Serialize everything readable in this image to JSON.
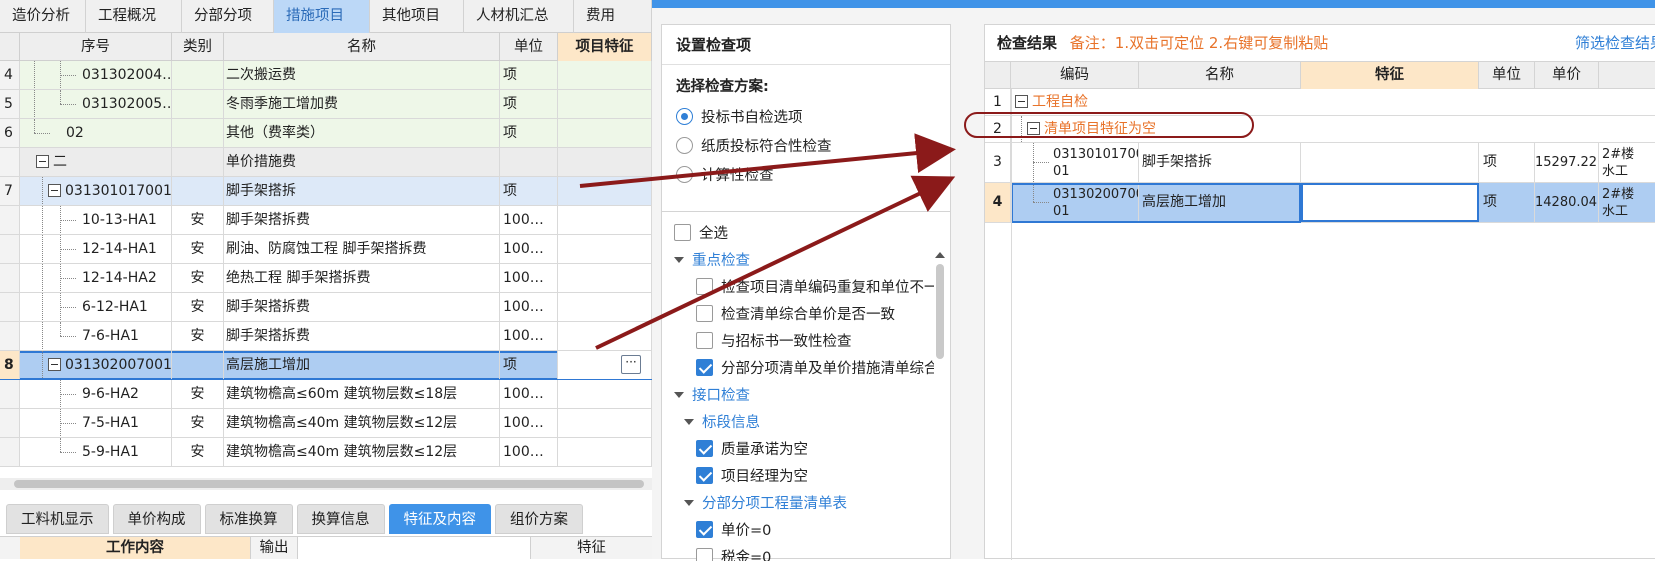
{
  "left": {
    "tabs": [
      {
        "label": "造价分析"
      },
      {
        "label": "工程概况"
      },
      {
        "label": "分部分项"
      },
      {
        "label": "措施项目",
        "active": true
      },
      {
        "label": "其他项目"
      },
      {
        "label": "人材机汇总"
      },
      {
        "label": "费用"
      }
    ],
    "columns": {
      "seq": "序号",
      "type": "类别",
      "name": "名称",
      "unit": "单位",
      "feature": "项目特征"
    },
    "rows": [
      {
        "idx": "4",
        "seq": "031302004…",
        "type": "",
        "name": "二次搬运费",
        "unit": "项"
      },
      {
        "idx": "5",
        "seq": "031302005…",
        "type": "",
        "name": "冬雨季施工增加费",
        "unit": "项"
      },
      {
        "idx": "6",
        "seq": "02",
        "type": "",
        "name": "其他（费率类）",
        "unit": "项"
      },
      {
        "idx": "",
        "seq": "二",
        "type": "",
        "name": "单价措施费",
        "unit": ""
      },
      {
        "idx": "7",
        "seq": "031301017001",
        "type": "",
        "name": "脚手架搭拆",
        "unit": "项"
      },
      {
        "idx": "",
        "seq": "10-13-HA1",
        "type": "安",
        "name": "脚手架搭拆费",
        "unit": "100…"
      },
      {
        "idx": "",
        "seq": "12-14-HA1",
        "type": "安",
        "name": "刷油、防腐蚀工程 脚手架搭拆费",
        "unit": "100…"
      },
      {
        "idx": "",
        "seq": "12-14-HA2",
        "type": "安",
        "name": "绝热工程 脚手架搭拆费",
        "unit": "100…"
      },
      {
        "idx": "",
        "seq": "6-12-HA1",
        "type": "安",
        "name": "脚手架搭拆费",
        "unit": "100…"
      },
      {
        "idx": "",
        "seq": "7-6-HA1",
        "type": "安",
        "name": "脚手架搭拆费",
        "unit": "100…"
      },
      {
        "idx": "8",
        "seq": "031302007001",
        "type": "",
        "name": "高层施工增加",
        "unit": "项"
      },
      {
        "idx": "",
        "seq": "9-6-HA2",
        "type": "安",
        "name": "建筑物檐高≤60m 建筑物层数≤18层",
        "unit": "100…"
      },
      {
        "idx": "",
        "seq": "7-5-HA1",
        "type": "安",
        "name": "建筑物檐高≤40m 建筑物层数≤12层",
        "unit": "100…"
      },
      {
        "idx": "",
        "seq": "5-9-HA1",
        "type": "安",
        "name": "建筑物檐高≤40m 建筑物层数≤12层",
        "unit": "100…"
      }
    ],
    "bottom_tabs": [
      {
        "label": "工料机显示"
      },
      {
        "label": "单价构成"
      },
      {
        "label": "标准换算"
      },
      {
        "label": "换算信息"
      },
      {
        "label": "特征及内容",
        "active": true
      },
      {
        "label": "组价方案"
      }
    ],
    "bottom_head": {
      "work": "工作内容",
      "output": "输出",
      "feature": "特征"
    }
  },
  "dialog": {
    "settings": {
      "title": "设置检查项",
      "scheme_label": "选择检查方案:",
      "options": [
        {
          "label": "投标书自检选项",
          "checked": true
        },
        {
          "label": "纸质投标符合性检查",
          "checked": false
        },
        {
          "label": "计算性检查",
          "checked": false
        }
      ],
      "select_all": "全选",
      "group_key": "重点检查",
      "key_items": [
        {
          "label": "检查项目清单编码重复和单位不一致",
          "checked": false
        },
        {
          "label": "检查清单综合单价是否一致",
          "checked": false
        },
        {
          "label": "与招标书一致性检查",
          "checked": false
        },
        {
          "label": "分部分项清单及单价措施清单综合单价",
          "checked": true
        }
      ],
      "group_interface": "接口检查",
      "sub_tender": "标段信息",
      "tender_items": [
        {
          "label": "质量承诺为空",
          "checked": true
        },
        {
          "label": "项目经理为空",
          "checked": true
        }
      ],
      "sub_bill": "分部分项工程量清单表",
      "bill_items": [
        {
          "label": "单价=0",
          "checked": true
        },
        {
          "label": "税金=0",
          "checked": false
        }
      ]
    },
    "results": {
      "title": "检查结果",
      "note": "备注：1.双击可定位 2.右键可复制粘贴",
      "filter": "筛选检查结果",
      "columns": {
        "code": "编码",
        "name": "名称",
        "feature": "特征",
        "unit": "单位",
        "price": "单价"
      },
      "rows": [
        {
          "idx": "1",
          "code": "工程自检",
          "name": "",
          "unit": "",
          "price": "",
          "extra": ""
        },
        {
          "idx": "2",
          "code": "清单项目特征为空",
          "name": "",
          "unit": "",
          "price": "",
          "extra": ""
        },
        {
          "idx": "3",
          "code": "031301017001",
          "code_l1": "03130101700",
          "code_l2": "01",
          "name": "脚手架搭拆",
          "unit": "项",
          "price": "15297.22",
          "extra1": "2#楼",
          "extra2": "水工"
        },
        {
          "idx": "4",
          "code": "031302007001",
          "code_l1": "03130200700",
          "code_l2": "01",
          "name": "高层施工增加",
          "unit": "项",
          "price": "14280.04",
          "extra1": "2#楼",
          "extra2": "水工"
        }
      ]
    }
  },
  "colors": {
    "accent": "#3f93e8",
    "orange": "#e8732a",
    "annotation": "#8b1a1a"
  }
}
